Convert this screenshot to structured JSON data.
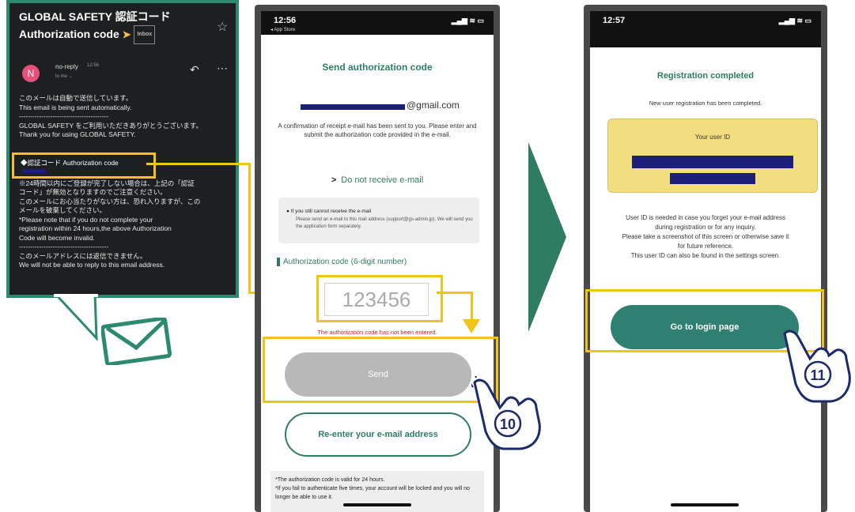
{
  "email": {
    "subject_line1": "GLOBAL SAFETY 認証コード",
    "subject_line2": "Authorization code",
    "inbox_tag": "Inbox",
    "avatar_letter": "N",
    "from": "no-reply",
    "time": "12:56",
    "to": "to me",
    "body_lines": [
      "このメールは自動で送信しています。",
      "This email is being sent automatically.",
      "----------------------------------------",
      "GLOBAL SAFETY をご利用いただきありがとうございます。",
      "Thank you for using GLOBAL SAFETY."
    ],
    "code_label": "◆認証コード Authorization code",
    "body_lines_2": [
      "※24時間以内にご登録が完了しない場合は、上記の「認証",
      "コード」が無効となりますのでご注意ください。",
      "このメールにお心当たりがない方は、恐れ入りますが、この",
      "メールを破棄してください。",
      "*Please note that if you do not complete your",
      "registration within 24 hours,the above Authorization",
      "Code will become invalid.",
      "----------------------------------------",
      "このメールアドレスには返信できません。",
      "We will not be able to reply to this email address."
    ]
  },
  "phone1": {
    "clock": "12:56",
    "back": "◂ App Store",
    "status_icons": "▂▄▆ ≋ ▭",
    "title": "Send authorization code",
    "gmail": "@gmail.com",
    "description": "A confirmation of receipt e-mail has been sent to you. Please enter and submit the authorization code provided in the e-mail.",
    "no_receive": "Do not receive e-mail",
    "notice_title": "If you still cannot receive the e-mail",
    "notice_body": "Please send an e-mail to this mail address (support@gs-admin.jp). We will send you the application form separately.",
    "code_header": "Authorization code (6-digit number)",
    "code_placeholder": "123456",
    "error": "The authorization code has not been entered.",
    "send": "Send",
    "reenter": "Re-enter your e-mail address",
    "footer_line1": "*The authorization code is valid for 24 hours.",
    "footer_line2": "*If you fail to authenticate five times, your account will be locked and you will no longer be able to use it."
  },
  "phone2": {
    "clock": "12:57",
    "status_icons": "▂▄▆ ≋ ▭",
    "title": "Registration completed",
    "description": "New user registration has been completed.",
    "user_id_label": "Your user ID",
    "info_lines": [
      "User ID is needed in case you forget your e-mail address",
      "during registration or for any inquiry.",
      "Please take a screenshot of this screen or otherwise save it",
      "for future reference.",
      "This user ID can also be found in the settings screen."
    ],
    "login": "Go to login page"
  },
  "steps": {
    "step10": "10",
    "step11": "11"
  },
  "colors": {
    "accent_green": "#2e7d63",
    "highlight_yellow": "#f0c419",
    "redaction_navy": "#1c1f7a"
  }
}
